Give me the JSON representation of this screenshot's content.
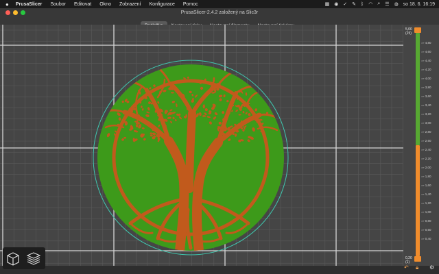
{
  "menubar": {
    "apple": "",
    "app": "PrusaSlicer",
    "items": [
      "Soubor",
      "Editovat",
      "Okno",
      "Zobrazení",
      "Konfigurace",
      "Pomoc"
    ],
    "clock": "so 18. 6.  16:19"
  },
  "window": {
    "title": "PrusaSlicer-2.4.2 založený na Slic3r",
    "tabs": [
      "Podložka",
      "Nastavení tisku",
      "Nastavení filamentu",
      "Nastavení tiskárny"
    ],
    "active_tab": 0
  },
  "layer_slider": {
    "top_value": "5,00",
    "top_layer": "(25)",
    "bottom_value": "0,20",
    "bottom_layer": "(1)",
    "ticks": [
      "4,80",
      "4,60",
      "4,40",
      "4,20",
      "4,00",
      "3,80",
      "3,60",
      "3,40",
      "3,20",
      "3,00",
      "2,80",
      "2,60",
      "2,40",
      "2,20",
      "2,00",
      "1,80",
      "1,60",
      "1,40",
      "1,20",
      "1,00",
      "0,80",
      "0,60",
      "0,40"
    ],
    "color_change_at": "2,60",
    "upper_color": "#57a832",
    "lower_color": "#f08c2c"
  },
  "model": {
    "base_color": "#3d9a1a",
    "tree_color": "#c15a1c"
  },
  "bottom_icons": [
    "cube-icon",
    "layers-icon"
  ],
  "slider_footer_icons": [
    "undo-icon",
    "lock-icon",
    "settings-icon"
  ]
}
